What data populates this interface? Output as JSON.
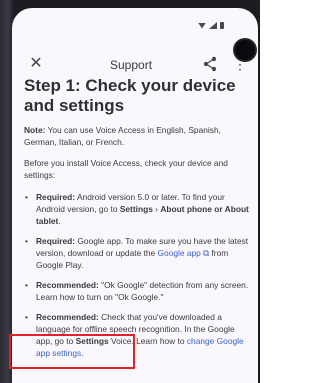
{
  "toolbar": {
    "title": "Support"
  },
  "content": {
    "heading": "Step 1: Check your device and settings",
    "note_label": "Note:",
    "note_text": " You can use Voice Access in English, Spanish, German, Italian, or French.",
    "intro": "Before you install Voice Access, check your device and settings:",
    "req_android_label": "Required:",
    "req_android_text": " Android version 5.0 or later. To find your Android version, go to ",
    "req_android_settings": "Settings",
    "req_android_sep": " › ",
    "req_android_about": "About phone or About tablet",
    "req_android_end": ".",
    "req_google_label": "Required:",
    "req_google_text": " Google app. To make sure you have the latest version, download or update the ",
    "req_google_link": "Google app",
    "req_google_end": " from Google Play.",
    "rec_ok_label": "Recommended:",
    "rec_ok_text": " \"Ok Google\" detection from any screen. Learn how to turn on \"Ok Google.\"",
    "rec_lang_label": "Recommended:",
    "rec_lang_text": " Check that you've downloaded a language for offline speech recognition. In the Google app, go to ",
    "rec_lang_settings": "Settings",
    "rec_lang_mid": " Voice. Learn how to ",
    "rec_lang_link": "change Google app settings",
    "rec_lang_end": "."
  }
}
